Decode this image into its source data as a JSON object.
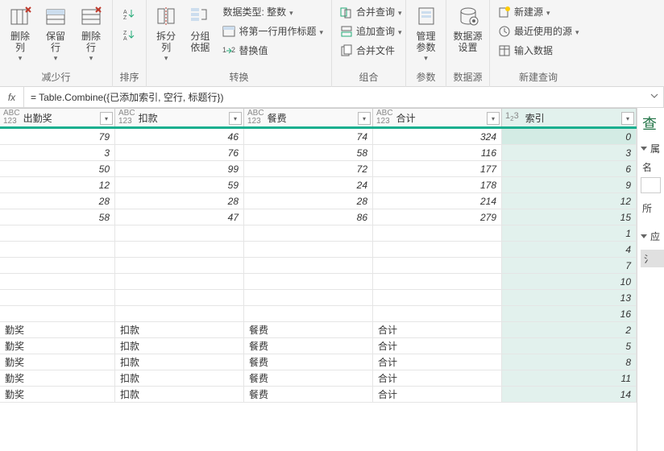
{
  "ribbon": {
    "group_reduce": {
      "label": "减少行",
      "remove_rows": "删除\n列",
      "keep_rows": "保留\n行",
      "remove_rows2": "删除\n行"
    },
    "group_sort": {
      "label": "排序"
    },
    "group_transform": {
      "label": "转换",
      "split": "拆分\n列",
      "group_by": "分组\n依据",
      "datatype": "数据类型: 整数",
      "first_row": "将第一行用作标题",
      "replace": "替换值"
    },
    "group_combine": {
      "label": "组合",
      "merge": "合并查询",
      "append": "追加查询",
      "merge_files": "合并文件"
    },
    "group_params": {
      "label": "参数",
      "manage": "管理\n参数"
    },
    "group_datasource": {
      "label": "数据源",
      "settings": "数据源\n设置"
    },
    "group_newquery": {
      "label": "新建查询",
      "new_source": "新建源",
      "recent": "最近使用的源",
      "enter_data": "输入数据"
    }
  },
  "formula_bar": {
    "fx": "fx",
    "formula": "= Table.Combine({已添加索引, 空行, 标题行})"
  },
  "columns": {
    "c0": {
      "type": "ABC\n123",
      "name": "出勤奖"
    },
    "c1": {
      "type": "ABC\n123",
      "name": "扣款"
    },
    "c2": {
      "type": "ABC\n123",
      "name": "餐费"
    },
    "c3": {
      "type": "ABC\n123",
      "name": "合计"
    },
    "c4": {
      "type": "1₂3",
      "name": "索引"
    }
  },
  "rows": [
    {
      "c0": "79",
      "c1": "46",
      "c2": "74",
      "c3": "324",
      "c4": "0",
      "num": true
    },
    {
      "c0": "3",
      "c1": "76",
      "c2": "58",
      "c3": "116",
      "c4": "3",
      "num": true
    },
    {
      "c0": "50",
      "c1": "99",
      "c2": "72",
      "c3": "177",
      "c4": "6",
      "num": true
    },
    {
      "c0": "12",
      "c1": "59",
      "c2": "24",
      "c3": "178",
      "c4": "9",
      "num": true
    },
    {
      "c0": "28",
      "c1": "28",
      "c2": "28",
      "c3": "214",
      "c4": "12",
      "num": true
    },
    {
      "c0": "58",
      "c1": "47",
      "c2": "86",
      "c3": "279",
      "c4": "15",
      "num": true
    },
    {
      "c0": "",
      "c1": "",
      "c2": "",
      "c3": "",
      "c4": "1",
      "num": true
    },
    {
      "c0": "",
      "c1": "",
      "c2": "",
      "c3": "",
      "c4": "4",
      "num": true
    },
    {
      "c0": "",
      "c1": "",
      "c2": "",
      "c3": "",
      "c4": "7",
      "num": true
    },
    {
      "c0": "",
      "c1": "",
      "c2": "",
      "c3": "",
      "c4": "10",
      "num": true
    },
    {
      "c0": "",
      "c1": "",
      "c2": "",
      "c3": "",
      "c4": "13",
      "num": true
    },
    {
      "c0": "",
      "c1": "",
      "c2": "",
      "c3": "",
      "c4": "16",
      "num": true
    },
    {
      "c0": "勤奖",
      "c1": "扣款",
      "c2": "餐费",
      "c3": "合计",
      "c4": "2",
      "num": false
    },
    {
      "c0": "勤奖",
      "c1": "扣款",
      "c2": "餐费",
      "c3": "合计",
      "c4": "5",
      "num": false
    },
    {
      "c0": "勤奖",
      "c1": "扣款",
      "c2": "餐费",
      "c3": "合计",
      "c4": "8",
      "num": false
    },
    {
      "c0": "勤奖",
      "c1": "扣款",
      "c2": "餐费",
      "c3": "合计",
      "c4": "11",
      "num": false
    },
    {
      "c0": "勤奖",
      "c1": "扣款",
      "c2": "餐费",
      "c3": "合计",
      "c4": "14",
      "num": false
    }
  ],
  "right_panel": {
    "title": "查",
    "sec1": "属",
    "name_label": "名",
    "all_label": "所",
    "sec2": "应",
    "step": "氵"
  }
}
